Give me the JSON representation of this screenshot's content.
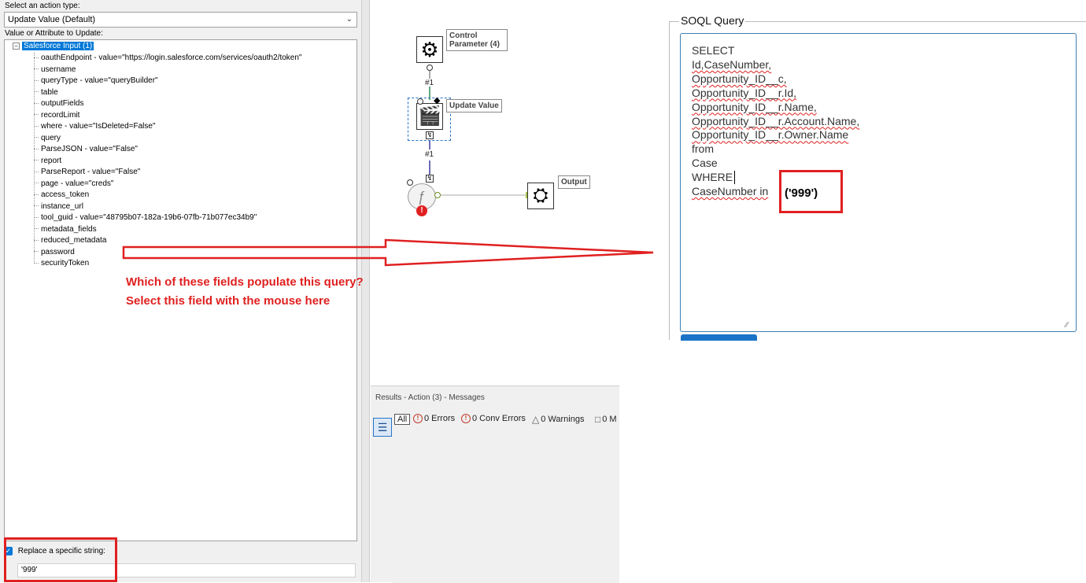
{
  "left_panel": {
    "action_type_label": "Select an action type:",
    "action_type_value": "Update Value (Default)",
    "value_label": "Value or Attribute to Update:",
    "tree": {
      "root": "Salesforce Input (1)",
      "items": [
        "oauthEndpoint - value=\"https://login.salesforce.com/services/oauth2/token\"",
        "username",
        "queryType - value=\"queryBuilder\"",
        "table",
        "outputFields",
        "recordLimit",
        "where - value=\"IsDeleted=False\"",
        "query",
        "ParseJSON - value=\"False\"",
        "report",
        "ParseReport - value=\"False\"",
        "page - value=\"creds\"",
        "access_token",
        "instance_url",
        "tool_guid - value=\"48795b07-182a-19b6-07fb-71b077ec34b9\"",
        "metadata_fields",
        "reduced_metadata",
        "password",
        "securityToken"
      ]
    },
    "replace_label": "Replace a specific string:",
    "replace_value": "'999'"
  },
  "canvas": {
    "tools": [
      {
        "label": "Control Parameter (4)",
        "icon": "gear-icon"
      },
      {
        "label": "Update Value",
        "icon": "clapperboard-icon"
      },
      {
        "label": "",
        "icon": "salesforce-input-icon"
      },
      {
        "label": "Output",
        "icon": "macro-output-icon"
      }
    ],
    "connection_labels": [
      "#1",
      "#1"
    ],
    "error_glyph": "!",
    "q_anchor": "Q"
  },
  "annotation": {
    "line1": "Which of these fields populate this query?",
    "line2": "Select this field with the mouse here",
    "color": "#e02020"
  },
  "results": {
    "title": "Results - Action (3) - Messages",
    "all": "All",
    "errors": "0 Errors",
    "conv_errors": "0 Conv Errors",
    "warnings": "0 Warnings",
    "more": "0 M"
  },
  "soql": {
    "legend": "SOQL Query",
    "lines": [
      "SELECT",
      "Id,CaseNumber,",
      "Opportunity_ID__c,",
      "Opportunity_ID__r.Id,",
      "Opportunity_ID__r.Name,",
      "Opportunity_ID__r.Account.Name,",
      "Opportunity_ID__r.Owner.Name",
      "from",
      "Case",
      "WHERE",
      "CaseNumber in"
    ],
    "highlighted_value": "('999')"
  },
  "colors": {
    "accent": "#0078d7",
    "annotation_red": "#e02020",
    "textbox_border": "#3c7fb1"
  }
}
